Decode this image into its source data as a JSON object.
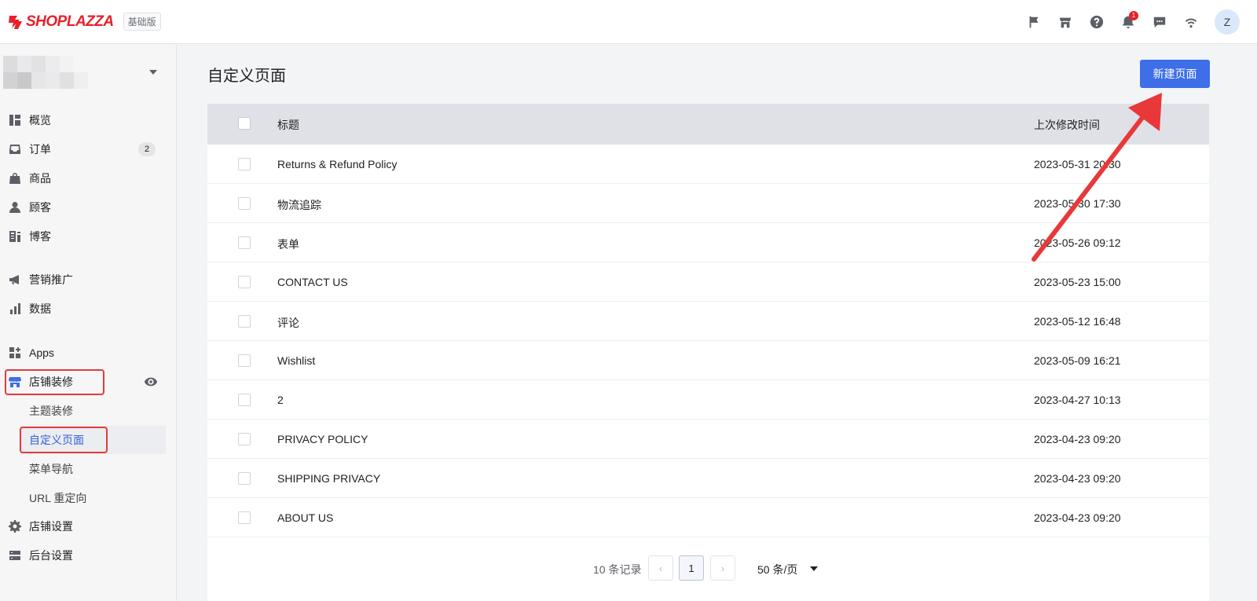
{
  "app": {
    "logo_text": "SHOPLAZZA",
    "plan_badge": "基础版",
    "notification_count": "1",
    "avatar_initial": "Z",
    "brand_color": "#e8202a",
    "primary_color": "#3e6ee8"
  },
  "topbar_icons": [
    "flag-icon",
    "store-icon",
    "help-icon",
    "bell-icon",
    "chat-icon",
    "wifi-icon"
  ],
  "sidebar": {
    "items": [
      {
        "label": "概览",
        "icon": "dashboard-icon"
      },
      {
        "label": "订单",
        "icon": "inbox-icon",
        "badge": "2"
      },
      {
        "label": "商品",
        "icon": "bag-icon"
      },
      {
        "label": "顾客",
        "icon": "person-icon"
      },
      {
        "label": "博客",
        "icon": "blog-icon"
      },
      {
        "label": "营销推广",
        "icon": "megaphone-icon"
      },
      {
        "label": "数据",
        "icon": "bar-chart-icon"
      },
      {
        "label": "Apps",
        "icon": "apps-icon"
      },
      {
        "label": "店铺装修",
        "icon": "storefront-icon"
      },
      {
        "label": "店铺设置",
        "icon": "gear-icon"
      },
      {
        "label": "后台设置",
        "icon": "server-icon"
      }
    ],
    "sub_items": [
      "主题装修",
      "自定义页面",
      "菜单导航",
      "URL 重定向"
    ],
    "active_sub_item": "自定义页面"
  },
  "main": {
    "title": "自定义页面",
    "new_button": "新建页面",
    "table": {
      "headers": [
        "标题",
        "上次修改时间"
      ],
      "rows": [
        {
          "title": "Returns & Refund Policy",
          "modified": "2023-05-31 20:30"
        },
        {
          "title": "物流追踪",
          "modified": "2023-05-30 17:30"
        },
        {
          "title": "表单",
          "modified": "2023-05-26 09:12"
        },
        {
          "title": "CONTACT US",
          "modified": "2023-05-23 15:00"
        },
        {
          "title": "评论",
          "modified": "2023-05-12 16:48"
        },
        {
          "title": "Wishlist",
          "modified": "2023-05-09 16:21"
        },
        {
          "title": "2",
          "modified": "2023-04-27 10:13"
        },
        {
          "title": "PRIVACY POLICY",
          "modified": "2023-04-23 09:20"
        },
        {
          "title": "SHIPPING PRIVACY",
          "modified": "2023-04-23 09:20"
        },
        {
          "title": "ABOUT US",
          "modified": "2023-04-23 09:20"
        }
      ]
    },
    "pagination": {
      "record_count": "10 条记录",
      "prev_symbol": "‹",
      "current_page": "1",
      "next_symbol": "›",
      "page_size": "50 条/页"
    }
  }
}
